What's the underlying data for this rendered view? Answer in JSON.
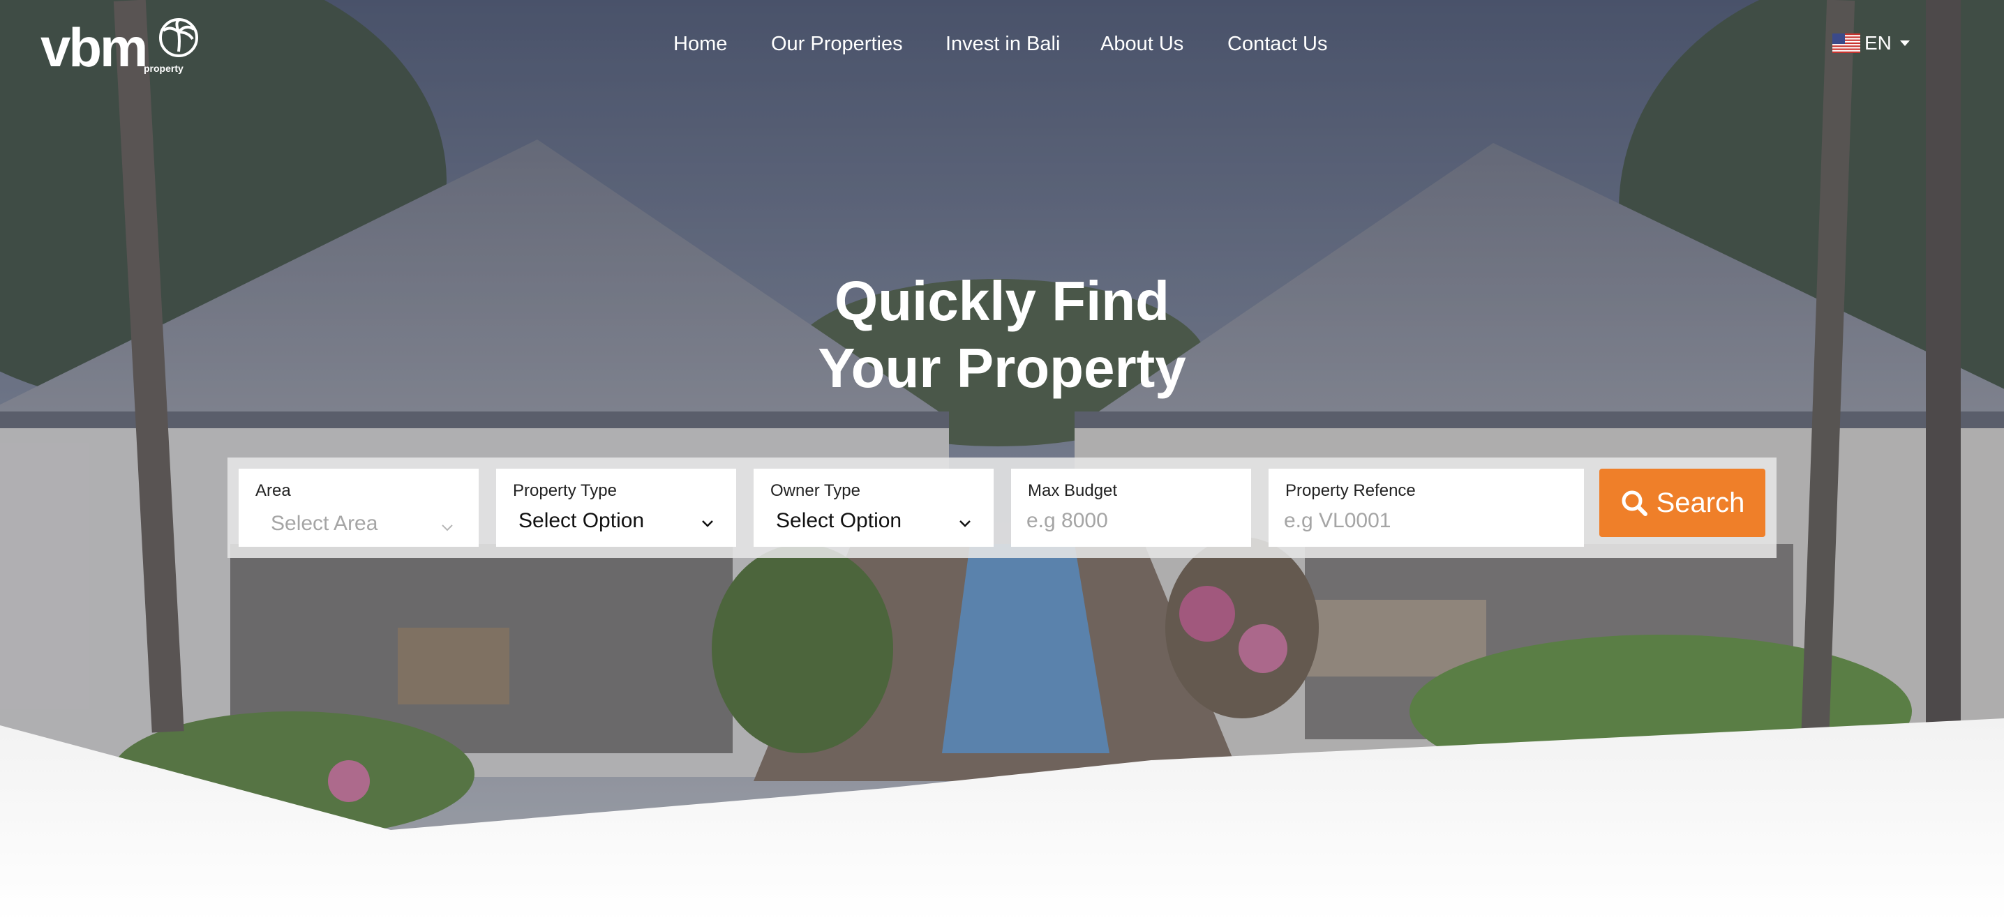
{
  "brand": {
    "logo_text": "vbm",
    "logo_sub": "property"
  },
  "nav": {
    "items": [
      {
        "label": "Home"
      },
      {
        "label": "Our Properties"
      },
      {
        "label": "Invest in Bali"
      },
      {
        "label": "About Us"
      },
      {
        "label": "Contact Us"
      }
    ],
    "language": "EN",
    "language_flag_icon": "us-flag-icon"
  },
  "hero": {
    "title_line1": "Quickly Find",
    "title_line2": "Your Property"
  },
  "search": {
    "area": {
      "label": "Area",
      "placeholder": "Select Area"
    },
    "property_type": {
      "label": "Property Type",
      "value": "Select Option"
    },
    "owner_type": {
      "label": "Owner Type",
      "value": "Select Option"
    },
    "max_budget": {
      "label": "Max Budget",
      "placeholder": "e.g 8000"
    },
    "property_reference": {
      "label": "Property Refence",
      "placeholder": "e.g VL0001"
    },
    "button_label": "Search",
    "button_color": "#ef7f29"
  }
}
